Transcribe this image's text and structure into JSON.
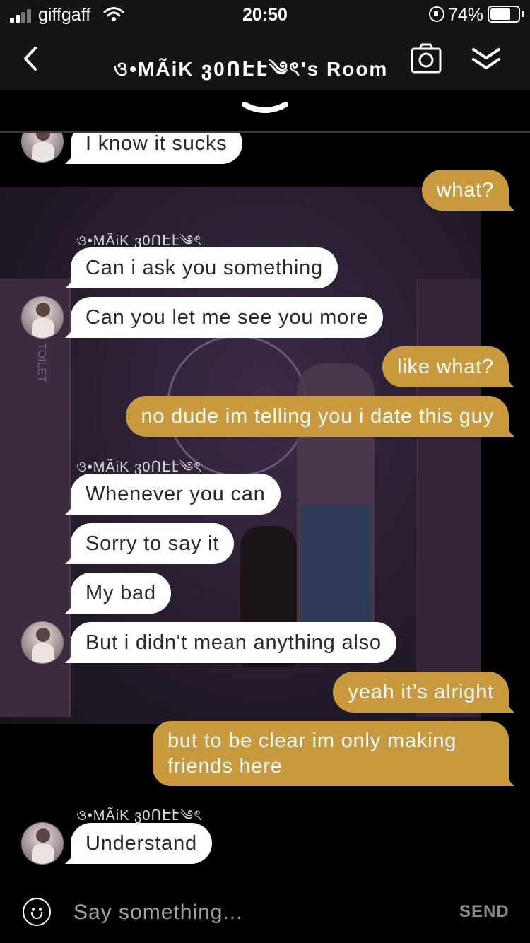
{
  "status_bar": {
    "carrier": "giffgaff",
    "time": "20:50",
    "battery_percent": "74%",
    "battery_level": 0.74
  },
  "header": {
    "title": "ও•MÃiK ვ0ՈԷէ༄ৎ's Room",
    "back_icon": "chevron-left-icon",
    "camera_icon": "camera-icon",
    "collapse_icon": "double-chevron-down-icon",
    "pull_handle_icon": "chevron-down-icon"
  },
  "messages": [
    {
      "direction": "in",
      "text": "I know it sucks",
      "avatar": true
    },
    {
      "direction": "out",
      "text": "what?"
    },
    {
      "direction": "in",
      "sender": "ও•MÃiK ვ0ՈԷէ༄ৎ",
      "text": "Can i ask you something"
    },
    {
      "direction": "in",
      "text": "Can you let me see you more",
      "avatar": true
    },
    {
      "direction": "out",
      "text": "like what?"
    },
    {
      "direction": "out",
      "text": "no dude im telling you i date this guy"
    },
    {
      "direction": "in",
      "sender": "ও•MÃiK ვ0ՈԷէ༄ৎ",
      "text": "Whenever you can"
    },
    {
      "direction": "in",
      "text": "Sorry to say it"
    },
    {
      "direction": "in",
      "text": "My bad"
    },
    {
      "direction": "in",
      "text": "But i didn't mean anything also",
      "avatar": true
    },
    {
      "direction": "out",
      "text": "yeah it’s alright"
    },
    {
      "direction": "out",
      "text": "but to be clear im only making friends here"
    },
    {
      "direction": "in",
      "sender": "ও•MÃiK ვ0ՈԷէ༄ৎ",
      "text": "Understand",
      "avatar": true
    }
  ],
  "scene": {
    "door_sign": "TOILET"
  },
  "input": {
    "placeholder": "Say something...",
    "send_label": "SEND",
    "emoji_icon": "smiley-icon"
  },
  "colors": {
    "outgoing_bubble": "#c9993e",
    "incoming_bubble": "#ffffff",
    "background": "#000000",
    "header": "#141414"
  }
}
